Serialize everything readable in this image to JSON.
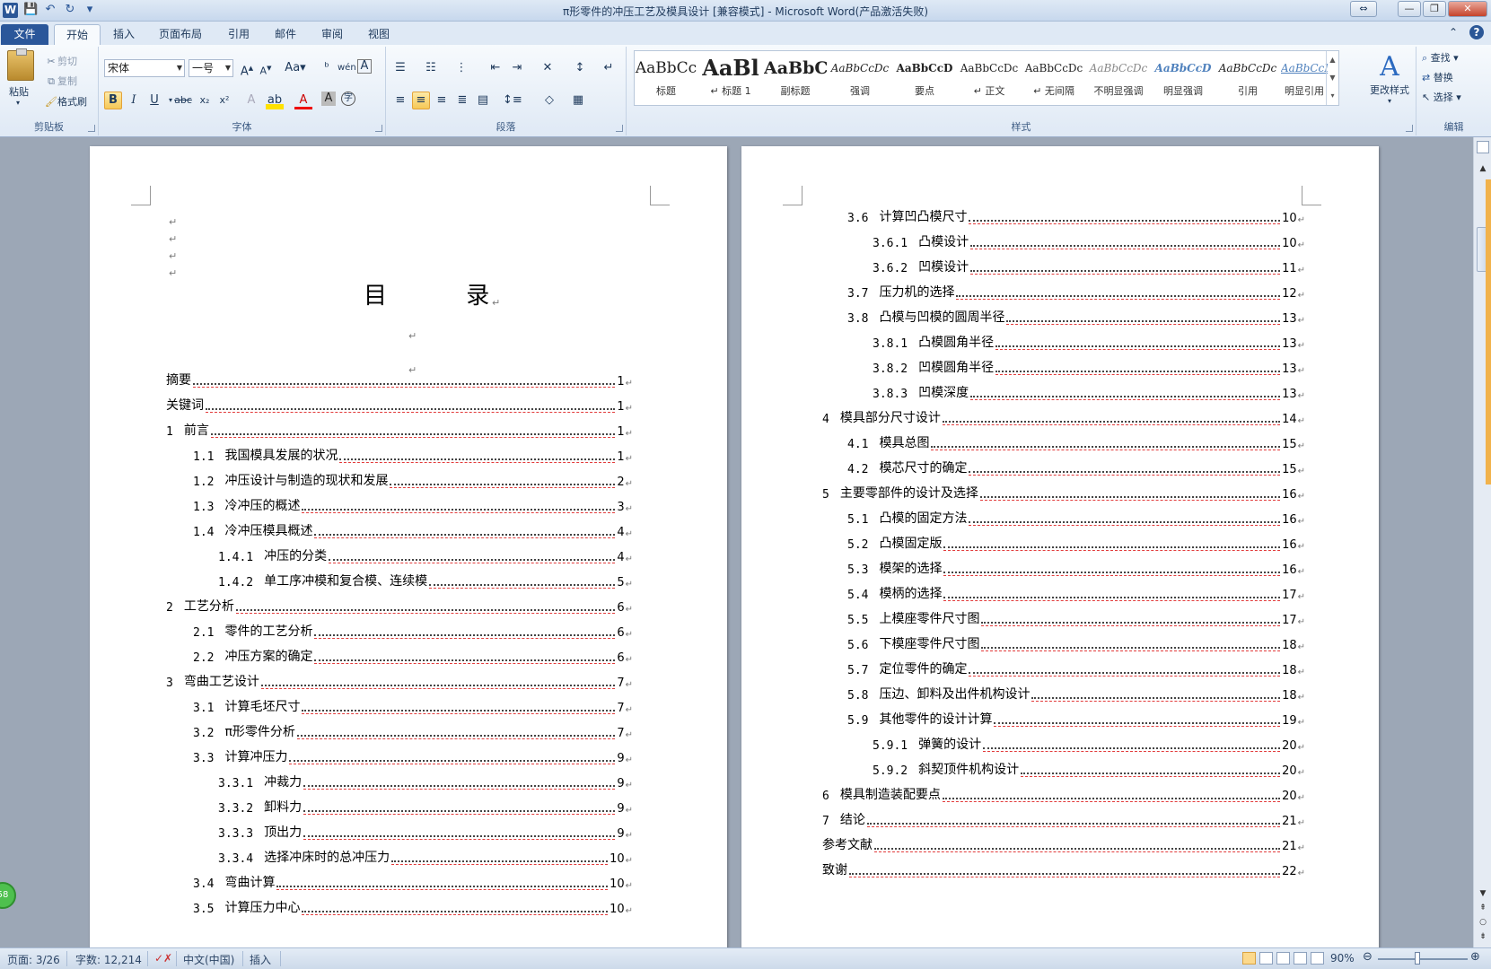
{
  "window": {
    "title": "π形零件的冲压工艺及模具设计 [兼容模式] - Microsoft Word(产品激活失败)",
    "logo": "W"
  },
  "tabs": [
    "文件",
    "开始",
    "插入",
    "页面布局",
    "引用",
    "邮件",
    "审阅",
    "视图"
  ],
  "ribbon": {
    "clipboard": {
      "label": "剪贴板",
      "paste": "粘贴",
      "cut": "剪切",
      "copy": "复制",
      "format_painter": "格式刷"
    },
    "font": {
      "label": "字体",
      "font_name": "宋体",
      "font_size": "一号"
    },
    "paragraph": {
      "label": "段落"
    },
    "styles": {
      "label": "样式",
      "change_styles": "更改样式",
      "items": [
        {
          "sample": "AaBbCc",
          "name": "标题"
        },
        {
          "sample": "AaBl",
          "name": "↵ 标题 1"
        },
        {
          "sample": "AaBbC",
          "name": "副标题"
        },
        {
          "sample": "AaBbCcDc",
          "name": "强调"
        },
        {
          "sample": "AaBbCcD",
          "name": "要点"
        },
        {
          "sample": "AaBbCcDc",
          "name": "↵ 正文"
        },
        {
          "sample": "AaBbCcDc",
          "name": "↵ 无间隔"
        },
        {
          "sample": "AaBbCcDc",
          "name": "不明显强调"
        },
        {
          "sample": "AaBbCcD",
          "name": "明显强调"
        },
        {
          "sample": "AaBbCcDc",
          "name": "引用"
        },
        {
          "sample": "AaBbCcDc",
          "name": "明显引用"
        }
      ]
    },
    "editing": {
      "label": "编辑",
      "find": "查找",
      "replace": "替换",
      "select": "选择"
    }
  },
  "document": {
    "toc_title": "目 录",
    "page1": [
      {
        "num": "",
        "text": "摘要",
        "page": "1",
        "level": 0
      },
      {
        "num": "",
        "text": "关键词",
        "page": "1",
        "level": 0
      },
      {
        "num": "1",
        "text": "前言",
        "page": "1",
        "level": 0
      },
      {
        "num": "1.1",
        "text": "我国模具发展的状况",
        "page": "1",
        "level": 1
      },
      {
        "num": "1.2",
        "text": "冲压设计与制造的现状和发展",
        "page": "2",
        "level": 1
      },
      {
        "num": "1.3",
        "text": "冷冲压的概述",
        "page": "3",
        "level": 1
      },
      {
        "num": "1.4",
        "text": "冷冲压模具概述",
        "page": "4",
        "level": 1
      },
      {
        "num": "1.4.1",
        "text": "冲压的分类",
        "page": "4",
        "level": 2
      },
      {
        "num": "1.4.2",
        "text": "单工序冲模和复合模、连续模",
        "page": "5",
        "level": 2
      },
      {
        "num": "2",
        "text": "工艺分析",
        "page": "6",
        "level": 0
      },
      {
        "num": "2.1",
        "text": "零件的工艺分析",
        "page": "6",
        "level": 1
      },
      {
        "num": "2.2",
        "text": "冲压方案的确定",
        "page": "6",
        "level": 1
      },
      {
        "num": "3",
        "text": "弯曲工艺设计",
        "page": "7",
        "level": 0
      },
      {
        "num": "3.1",
        "text": "计算毛坯尺寸",
        "page": "7",
        "level": 1
      },
      {
        "num": "3.2",
        "text": "π形零件分析",
        "page": "7",
        "level": 1
      },
      {
        "num": "3.3",
        "text": "计算冲压力",
        "page": "9",
        "level": 1
      },
      {
        "num": "3.3.1",
        "text": "冲裁力",
        "page": "9",
        "level": 2
      },
      {
        "num": "3.3.2",
        "text": "卸料力",
        "page": "9",
        "level": 2
      },
      {
        "num": "3.3.3",
        "text": "顶出力",
        "page": "9",
        "level": 2
      },
      {
        "num": "3.3.4",
        "text": "选择冲床时的总冲压力",
        "page": "10",
        "level": 2
      },
      {
        "num": "3.4",
        "text": "弯曲计算",
        "page": "10",
        "level": 1
      },
      {
        "num": "3.5",
        "text": "计算压力中心",
        "page": "10",
        "level": 1
      }
    ],
    "page2": [
      {
        "num": "3.6",
        "text": "计算凹凸模尺寸",
        "page": "10",
        "level": 1
      },
      {
        "num": "3.6.1",
        "text": "凸模设计",
        "page": "10",
        "level": 2
      },
      {
        "num": "3.6.2",
        "text": "凹模设计",
        "page": "11",
        "level": 2
      },
      {
        "num": "3.7",
        "text": "压力机的选择",
        "page": "12",
        "level": 1
      },
      {
        "num": "3.8",
        "text": "凸模与凹模的圆周半径",
        "page": "13",
        "level": 1
      },
      {
        "num": "3.8.1",
        "text": "凸模圆角半径",
        "page": "13",
        "level": 2
      },
      {
        "num": "3.8.2",
        "text": "凹模圆角半径",
        "page": "13",
        "level": 2
      },
      {
        "num": "3.8.3",
        "text": "凹模深度",
        "page": "13",
        "level": 2
      },
      {
        "num": "4",
        "text": "模具部分尺寸设计",
        "page": "14",
        "level": 0
      },
      {
        "num": "4.1",
        "text": "模具总图",
        "page": "15",
        "level": 1
      },
      {
        "num": "4.2",
        "text": "模芯尺寸的确定",
        "page": "15",
        "level": 1
      },
      {
        "num": "5",
        "text": "主要零部件的设计及选择",
        "page": "16",
        "level": 0
      },
      {
        "num": "5.1",
        "text": "凸模的固定方法",
        "page": "16",
        "level": 1
      },
      {
        "num": "5.2",
        "text": "凸模固定版",
        "page": "16",
        "level": 1
      },
      {
        "num": "5.3",
        "text": "模架的选择",
        "page": "16",
        "level": 1
      },
      {
        "num": "5.4",
        "text": "模柄的选择",
        "page": "17",
        "level": 1
      },
      {
        "num": "5.5",
        "text": "上模座零件尺寸图",
        "page": "17",
        "level": 1
      },
      {
        "num": "5.6",
        "text": "下模座零件尺寸图",
        "page": "18",
        "level": 1
      },
      {
        "num": "5.7",
        "text": "定位零件的确定",
        "page": "18",
        "level": 1
      },
      {
        "num": "5.8",
        "text": "压边、卸料及出件机构设计",
        "page": "18",
        "level": 1
      },
      {
        "num": "5.9",
        "text": "其他零件的设计计算",
        "page": "19",
        "level": 1
      },
      {
        "num": "5.9.1",
        "text": "弹簧的设计",
        "page": "20",
        "level": 2
      },
      {
        "num": "5.9.2",
        "text": "斜契顶件机构设计",
        "page": "20",
        "level": 2
      },
      {
        "num": "6",
        "text": "模具制造装配要点",
        "page": "20",
        "level": 0
      },
      {
        "num": "7",
        "text": "结论",
        "page": "21",
        "level": 0
      },
      {
        "num": "",
        "text": "参考文献",
        "page": "21",
        "level": 0
      },
      {
        "num": "",
        "text": "致谢",
        "page": "22",
        "level": 0
      }
    ]
  },
  "status": {
    "page": "页面: 3/26",
    "words": "字数: 12,214",
    "language": "中文(中国)",
    "mode": "插入",
    "zoom": "90%",
    "badge": "58"
  }
}
